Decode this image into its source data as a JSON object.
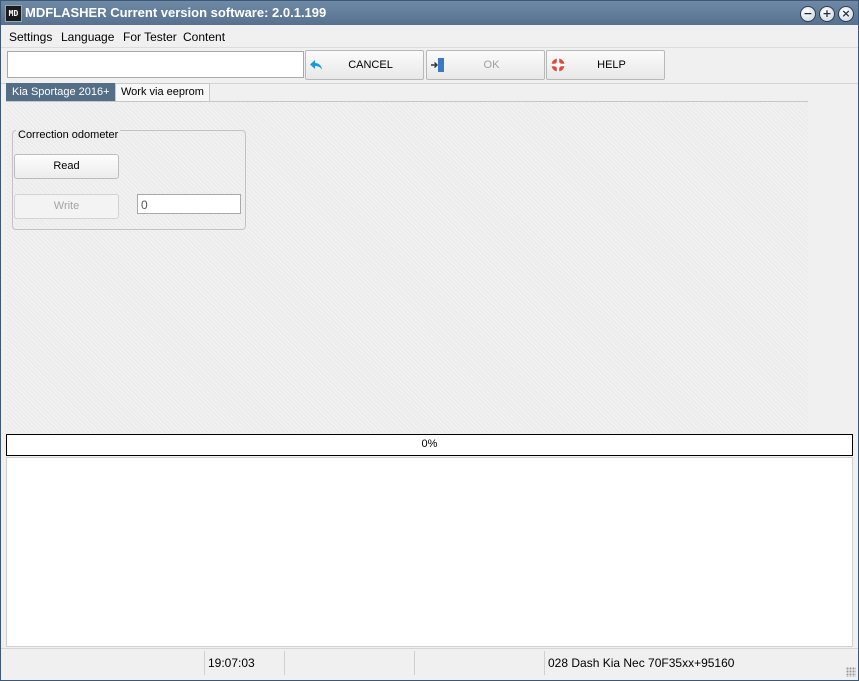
{
  "window": {
    "app_icon_text": "MD",
    "title": "MDFLASHER  Current version software: 2.0.1.199",
    "controls": {
      "minimize": "−",
      "maximize": "+",
      "close": "×"
    }
  },
  "menu": {
    "items": [
      "Settings",
      "Language",
      "For Tester",
      "Content"
    ]
  },
  "toolbar": {
    "status_value": "",
    "cancel_label": "CANCEL",
    "ok_label": "OK",
    "help_label": "HELP",
    "ok_enabled": false,
    "icons": {
      "cancel": "undo-arrow-icon",
      "ok": "door-enter-icon",
      "help": "lifebuoy-icon"
    },
    "colors": {
      "cancel_icon": "#1a9ad6",
      "ok_icon": "#3a78c8",
      "help_icon": "#e04a3a"
    }
  },
  "tabs": [
    {
      "label": "Kia Sportage 2016+",
      "active": true
    },
    {
      "label": "Work via eeprom",
      "active": false
    }
  ],
  "odometer_group": {
    "title": "Correction odometer",
    "read_label": "Read",
    "write_label": "Write",
    "write_enabled": false,
    "value": "0"
  },
  "progress": {
    "percent": 0,
    "text": "0%"
  },
  "statusbar": {
    "time": "19:07:03",
    "device": "028 Dash Kia Nec 70F35xx+95160"
  },
  "colors": {
    "titlebar": "#5f7b98",
    "active_tab": "#556e88",
    "progress_fill": "#3a7bd5"
  }
}
